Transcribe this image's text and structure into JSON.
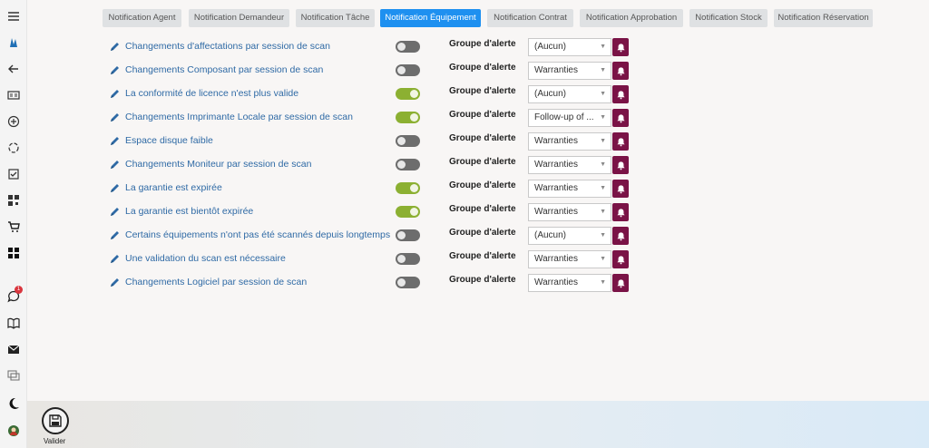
{
  "tabs": [
    {
      "label": "Notification Agent",
      "active": false
    },
    {
      "label": "Notification Demandeur",
      "active": false
    },
    {
      "label": "Notification Tâche",
      "active": false
    },
    {
      "label": "Notification Équipement",
      "active": true
    },
    {
      "label": "Notification Contrat",
      "active": false
    },
    {
      "label": "Notification Approbation",
      "active": false
    },
    {
      "label": "Notification Stock",
      "active": false
    },
    {
      "label": "Notification Réservation",
      "active": false
    }
  ],
  "rows": [
    {
      "label": "Changements d'affectations par session de scan",
      "enabled": false,
      "group_label": "Groupe d'alerte",
      "group_value": "(Aucun)"
    },
    {
      "label": "Changements Composant par session de scan",
      "enabled": false,
      "group_label": "Groupe d'alerte",
      "group_value": "Warranties"
    },
    {
      "label": "La conformité de licence n'est plus valide",
      "enabled": true,
      "group_label": "Groupe d'alerte",
      "group_value": "(Aucun)"
    },
    {
      "label": "Changements Imprimante Locale par session de scan",
      "enabled": true,
      "group_label": "Groupe d'alerte",
      "group_value": "Follow-up of ..."
    },
    {
      "label": "Espace disque faible",
      "enabled": false,
      "group_label": "Groupe d'alerte",
      "group_value": "Warranties"
    },
    {
      "label": "Changements Moniteur par session de scan",
      "enabled": false,
      "group_label": "Groupe d'alerte",
      "group_value": "Warranties"
    },
    {
      "label": "La garantie est expirée",
      "enabled": true,
      "group_label": "Groupe d'alerte",
      "group_value": "Warranties"
    },
    {
      "label": "La garantie est bientôt expirée",
      "enabled": true,
      "group_label": "Groupe d'alerte",
      "group_value": "Warranties"
    },
    {
      "label": "Certains équipements n'ont pas été scannés depuis longtemps",
      "enabled": false,
      "group_label": "Groupe d'alerte",
      "group_value": "(Aucun)"
    },
    {
      "label": "Une validation du scan est nécessaire",
      "enabled": false,
      "group_label": "Groupe d'alerte",
      "group_value": "Warranties"
    },
    {
      "label": "Changements Logiciel par session de scan",
      "enabled": false,
      "group_label": "Groupe d'alerte",
      "group_value": "Warranties"
    }
  ],
  "sidebar": {
    "icons": [
      "menu-icon",
      "brand-logo-icon",
      "back-arrow-icon",
      "id-card-icon",
      "plus-circle-icon",
      "settings-cycle-icon",
      "checkbox-icon",
      "qr-code-icon",
      "cart-icon",
      "grid-icon",
      "chat-icon",
      "book-icon",
      "mail-icon",
      "messages-icon",
      "moon-icon",
      "avatar"
    ],
    "chat_badge": "1"
  },
  "footer": {
    "save_label": "Valider"
  },
  "colors": {
    "accent": "#1e90f0",
    "toggle_on": "#8cb032",
    "toggle_off": "#6d6d6d",
    "bell_button": "#7a1346",
    "link_text": "#2f6aa5"
  }
}
